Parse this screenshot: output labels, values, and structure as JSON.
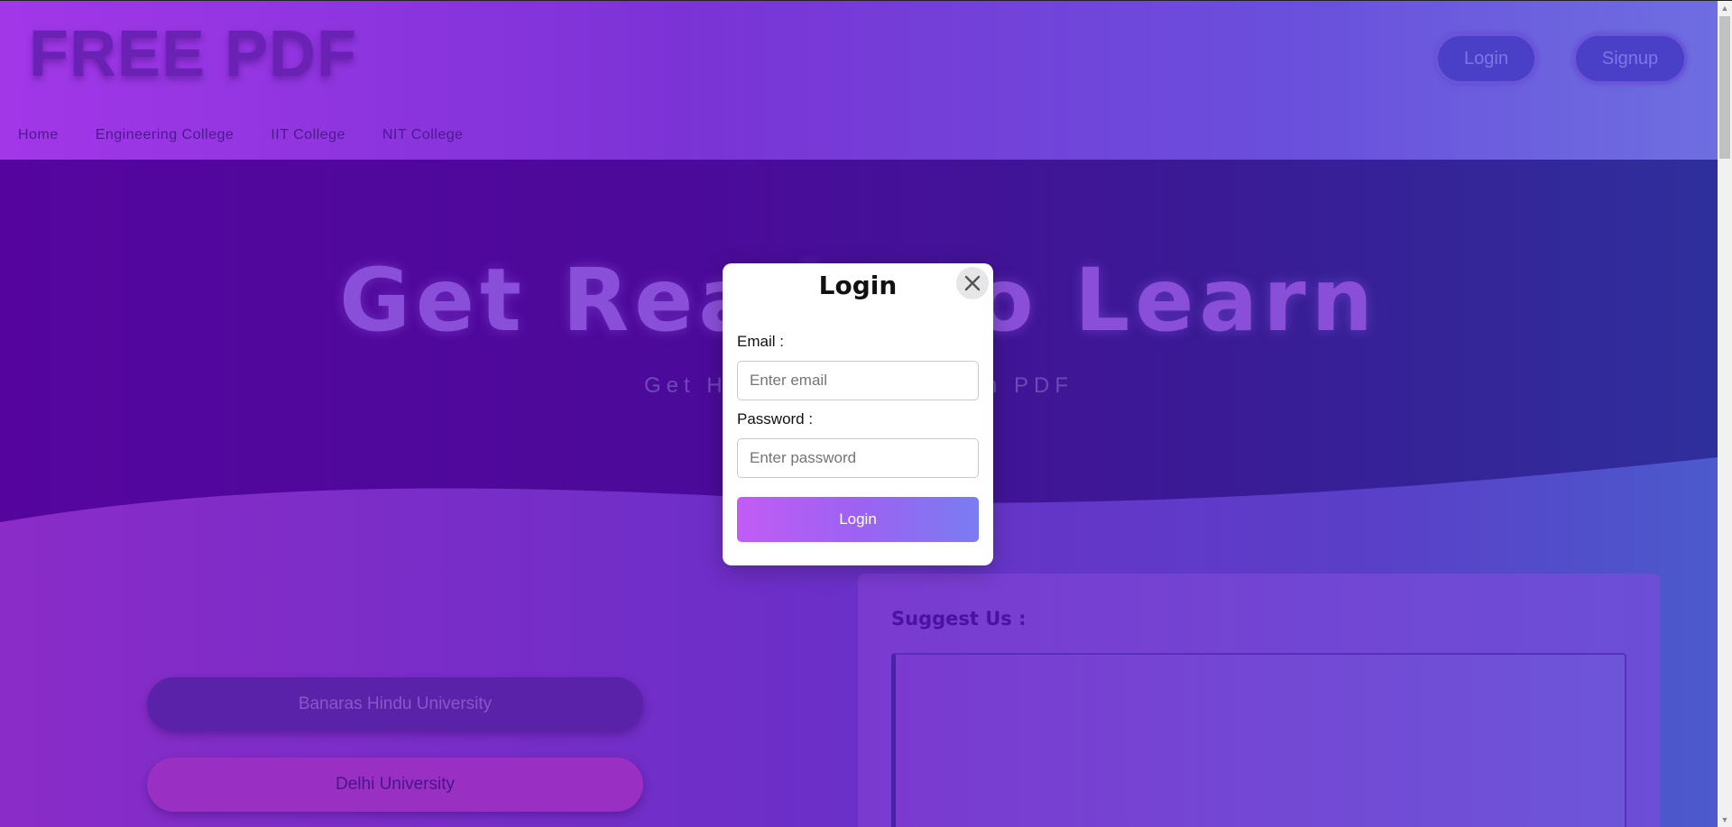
{
  "header": {
    "logo": "FREE PDF",
    "login_label": "Login",
    "signup_label": "Signup",
    "nav": [
      "Home",
      "Engineering College",
      "IIT College",
      "NIT College"
    ]
  },
  "hero": {
    "title": "Get Ready to Learn",
    "subtitle": "Get Here Previous Exam PDF"
  },
  "universities": [
    "Banaras Hindu University",
    "Delhi University"
  ],
  "suggest": {
    "title": "Suggest Us :"
  },
  "modal": {
    "title": "Login",
    "email_label": "Email :",
    "email_placeholder": "Enter email",
    "password_label": "Password :",
    "password_placeholder": "Enter password",
    "submit_label": "Login"
  },
  "colors": {
    "header_gradient_start": "#a237e8",
    "hero_bg": "#55059e",
    "modal_button_start": "#c25cf5",
    "modal_button_end": "#7b7cf2"
  }
}
